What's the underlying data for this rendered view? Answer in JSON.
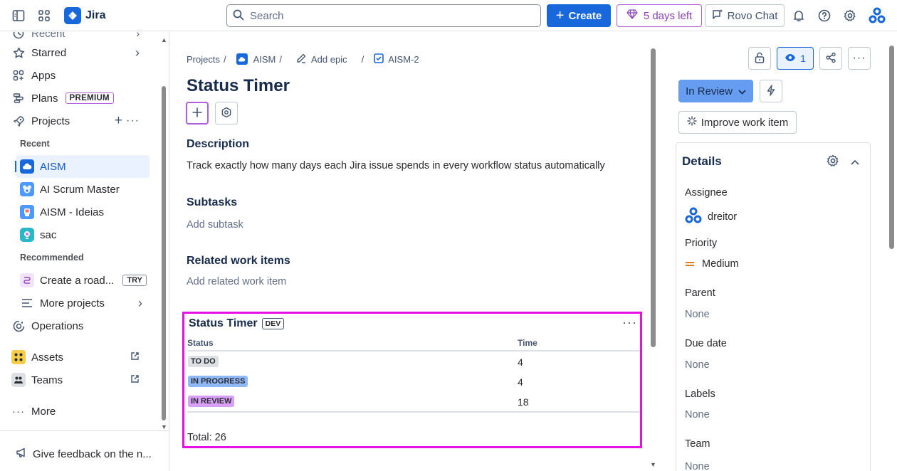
{
  "topbar": {
    "app_name": "Jira",
    "search_placeholder": "Search",
    "create_label": "Create",
    "trial_label": "5 days left",
    "rovo_label": "Rovo Chat"
  },
  "sidebar": {
    "cut_item": "Recent",
    "starred": "Starred",
    "apps": "Apps",
    "plans": "Plans",
    "plans_badge": "PREMIUM",
    "projects": "Projects",
    "recent_header": "Recent",
    "recent_projects": [
      "AISM",
      "AI Scrum Master",
      "AISM - Ideias",
      "sac"
    ],
    "recommended_header": "Recommended",
    "create_roadmap": "Create a road...",
    "try_badge": "TRY",
    "more_projects": "More projects",
    "operations": "Operations",
    "assets": "Assets",
    "teams": "Teams",
    "more": "More",
    "feedback": "Give feedback on the n..."
  },
  "breadcrumb": {
    "projects": "Projects",
    "project": "AISM",
    "add_epic": "Add epic",
    "issue_key": "AISM-2"
  },
  "issue": {
    "title": "Status Timer",
    "description_heading": "Description",
    "description": "Track exactly how many days each Jira issue spends in every workflow status automatically",
    "subtasks_heading": "Subtasks",
    "add_subtask": "Add subtask",
    "related_heading": "Related work items",
    "add_related": "Add related work item"
  },
  "status_timer": {
    "title": "Status Timer",
    "badge": "DEV",
    "col_status": "Status",
    "col_time": "Time",
    "rows": [
      {
        "status": "TO DO",
        "time": "4",
        "color": "#dcdfe4"
      },
      {
        "status": "IN PROGRESS",
        "time": "4",
        "color": "#8fb8f6"
      },
      {
        "status": "IN REVIEW",
        "time": "18",
        "color": "#d8a0f7"
      }
    ],
    "total": "Total: 26"
  },
  "right_panel": {
    "watchers": "1",
    "status": "In Review",
    "improve": "Improve work item",
    "details_title": "Details",
    "assignee_label": "Assignee",
    "assignee": "dreitor",
    "priority_label": "Priority",
    "priority": "Medium",
    "parent_label": "Parent",
    "parent": "None",
    "due_label": "Due date",
    "due": "None",
    "labels_label": "Labels",
    "labels": "None",
    "team_label": "Team",
    "team": "None"
  },
  "colors": {
    "brand": "#1868db",
    "highlight": "#e810e5",
    "trial": "#b05ed9"
  }
}
